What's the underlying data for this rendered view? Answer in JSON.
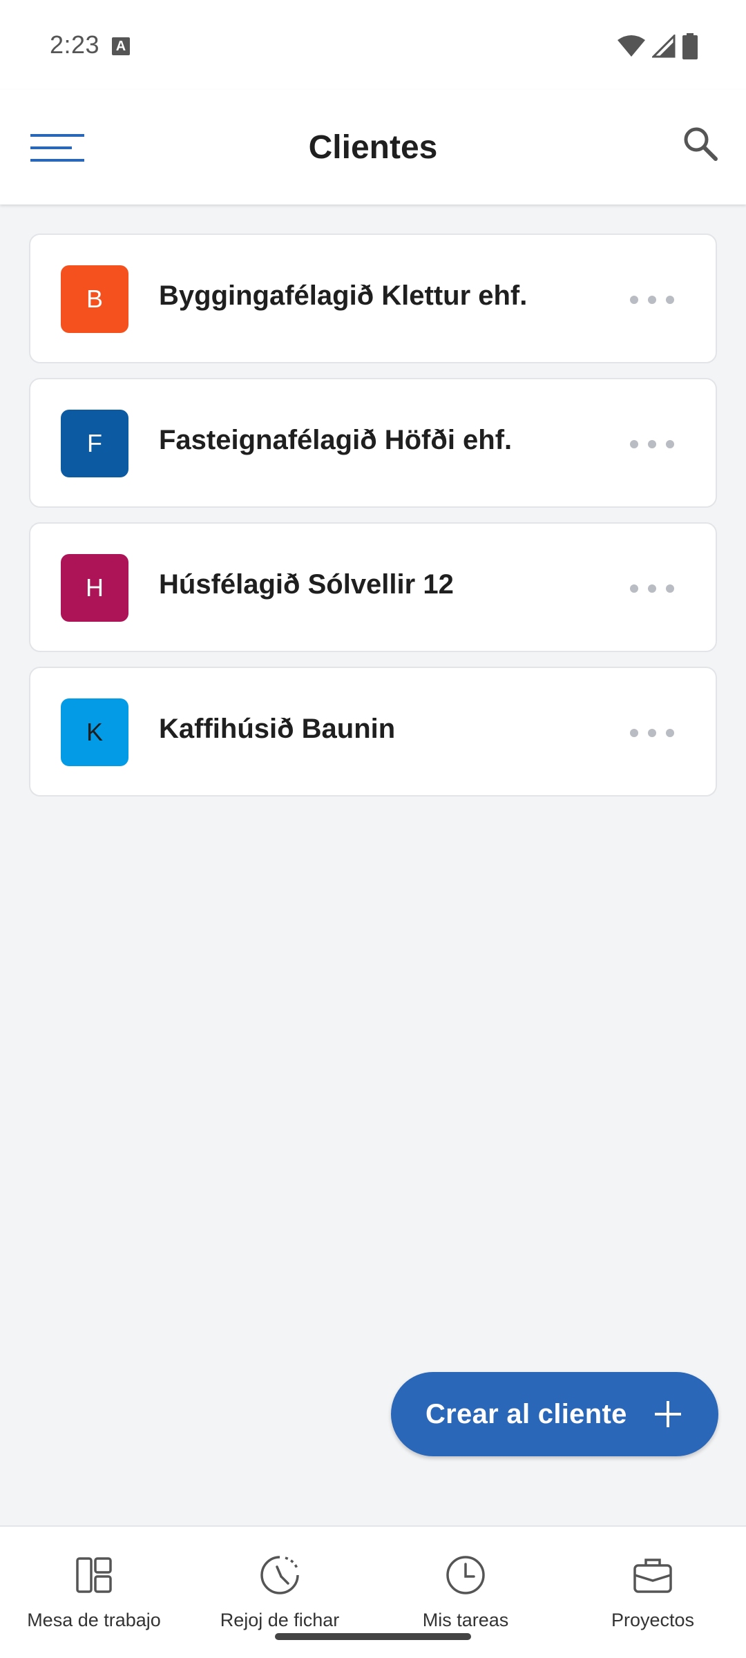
{
  "status_bar": {
    "time": "2:23",
    "notification_icon": "A",
    "icons": [
      "wifi-icon",
      "signal-icon",
      "battery-icon"
    ]
  },
  "app_bar": {
    "title": "Clientes",
    "menu_icon": "menu-icon",
    "search_icon": "search-icon",
    "accent_color": "#2a67b8"
  },
  "clients": [
    {
      "initial": "B",
      "name": "Byggingafélagið Klettur ehf.",
      "color": "#f4511e",
      "text_color": "#ffffff"
    },
    {
      "initial": "F",
      "name": "Fasteignafélagið Höfði ehf.",
      "color": "#0b5aa2",
      "text_color": "#ffffff"
    },
    {
      "initial": "H",
      "name": "Húsfélagið Sólvellir 12",
      "color": "#ad1457",
      "text_color": "#ffffff"
    },
    {
      "initial": "K",
      "name": "Kaffihúsið Baunin",
      "color": "#039be5",
      "text_color": "#1f1f1f"
    }
  ],
  "fab": {
    "label": "Crear al cliente",
    "icon": "plus-icon",
    "color": "#2a67b8"
  },
  "bottom_nav": [
    {
      "label": "Mesa de trabajo",
      "icon": "dashboard-icon"
    },
    {
      "label": "Rejoj de fichar",
      "icon": "time-clock-icon"
    },
    {
      "label": "Mis tareas",
      "icon": "clock-icon"
    },
    {
      "label": "Proyectos",
      "icon": "briefcase-icon"
    }
  ]
}
